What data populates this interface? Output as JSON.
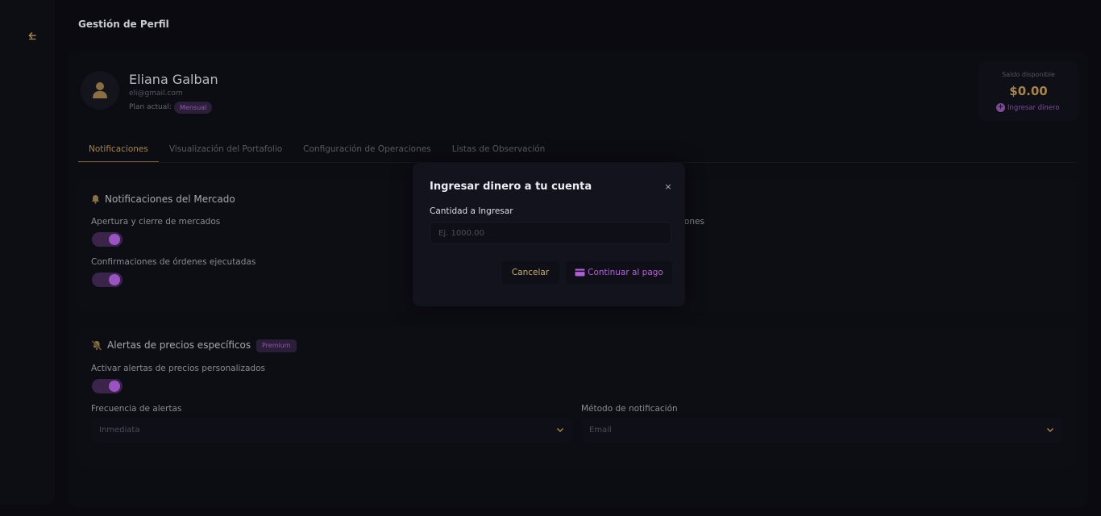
{
  "header": {
    "title": "Gestión de Perfil"
  },
  "sidebar": {
    "back_icon": "arrow-left-icon"
  },
  "profile": {
    "name": "Eliana Galban",
    "email": "eli@gmail.com",
    "plan_label": "Plan actual:",
    "plan_value": "Mensual",
    "avatar_icon": "user-icon"
  },
  "balance": {
    "label": "Saldo disponible",
    "value": "$0.00",
    "add_label": "Ingresar dinero",
    "add_icon": "plus-circle-icon"
  },
  "tabs": [
    {
      "label": "Notificaciones",
      "active": true
    },
    {
      "label": "Visualización del Portafolio",
      "active": false
    },
    {
      "label": "Configuración de Operaciones",
      "active": false
    },
    {
      "label": "Listas de Observación",
      "active": false
    }
  ],
  "market_notifications": {
    "title": "Notificaciones del Mercado",
    "icon": "bell-icon",
    "items": [
      {
        "label": "Apertura y cierre de mercados",
        "enabled": true
      },
      {
        "label": "Confirmaciones de órdenes ejecutadas",
        "enabled": true
      }
    ],
    "partial_label": "iones"
  },
  "price_alerts": {
    "title": "Alertas de precios específicos",
    "icon": "bell-off-icon",
    "badge": "Premium",
    "toggle_label": "Activar alertas de precios personalizados",
    "toggle_enabled": true,
    "frequency_label": "Frecuencia de alertas",
    "frequency_value": "Inmediata",
    "method_label": "Método de notificación",
    "method_value": "Email"
  },
  "modal": {
    "title": "Ingresar dinero a tu cuenta",
    "close": "×",
    "amount_label": "Cantidad a Ingresar",
    "amount_placeholder": "Ej. 1000.00",
    "cancel_label": "Cancelar",
    "pay_label": "Continuar al pago",
    "pay_icon": "credit-card-icon"
  },
  "colors": {
    "background": "#0a0a10",
    "accent_gold": "#a58549",
    "accent_purple": "#9a54c1"
  }
}
